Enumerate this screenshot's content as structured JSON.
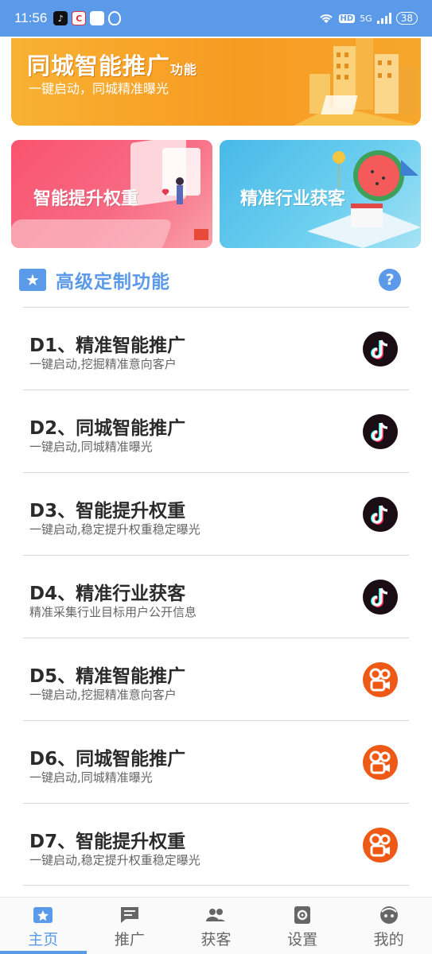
{
  "status_bar": {
    "time": "11:56",
    "network_label": "HD",
    "network_type": "5G",
    "battery": "38"
  },
  "banner_top": {
    "title": "同城智能推广",
    "title_suffix": "功能",
    "subtitle": "一键启动，同城精准曝光"
  },
  "cards": {
    "left_label": "智能提升权重",
    "right_label": "精准行业获客"
  },
  "section": {
    "title": "高级定制功能",
    "help_symbol": "?"
  },
  "items": [
    {
      "title": "D1、精准智能推广",
      "subtitle": "一键启动,挖掘精准意向客户",
      "icon": "tiktok-icon"
    },
    {
      "title": "D2、同城智能推广",
      "subtitle": "一键启动,同城精准曝光",
      "icon": "tiktok-icon"
    },
    {
      "title": "D3、智能提升权重",
      "subtitle": "一键启动,稳定提升权重稳定曝光",
      "icon": "tiktok-icon"
    },
    {
      "title": "D4、精准行业获客",
      "subtitle": "精准采集行业目标用户公开信息",
      "icon": "tiktok-icon"
    },
    {
      "title": "D5、精准智能推广",
      "subtitle": "一键启动,挖掘精准意向客户",
      "icon": "kuaishou-icon"
    },
    {
      "title": "D6、同城智能推广",
      "subtitle": "一键启动,同城精准曝光",
      "icon": "kuaishou-icon"
    },
    {
      "title": "D7、智能提升权重",
      "subtitle": "一键启动,稳定提升权重稳定曝光",
      "icon": "kuaishou-icon"
    }
  ],
  "nav": [
    {
      "label": "主页",
      "icon": "star-ticket-icon",
      "active": true
    },
    {
      "label": "推广",
      "icon": "chat-icon",
      "active": false
    },
    {
      "label": "获客",
      "icon": "people-icon",
      "active": false
    },
    {
      "label": "设置",
      "icon": "gear-icon",
      "active": false
    },
    {
      "label": "我的",
      "icon": "face-icon",
      "active": false
    }
  ],
  "colors": {
    "accent": "#5b9ae8",
    "banner_orange": "#f79a22",
    "card_pink": "#f9536f",
    "card_blue": "#47b9e8",
    "tiktok_bg": "#1a0e14",
    "kuaishou_bg": "#ee5a16"
  }
}
